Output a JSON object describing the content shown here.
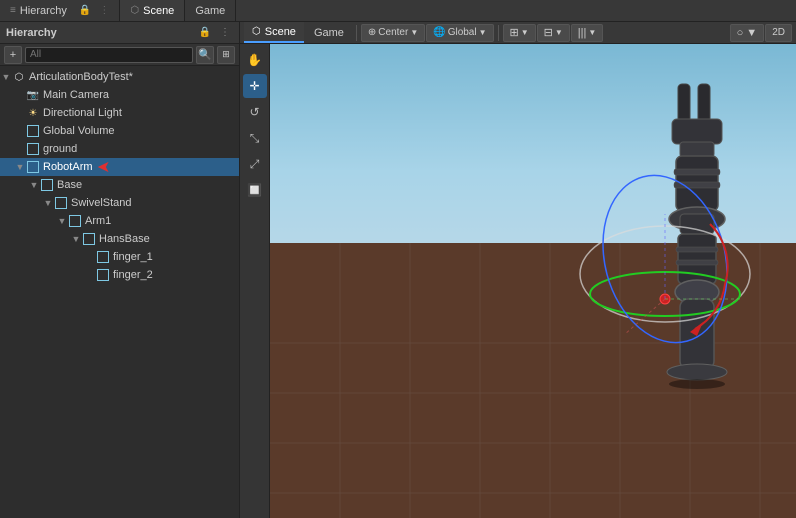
{
  "topBar": {
    "hierarchyTab": {
      "label": "Hierarchy",
      "icon": "≡",
      "active": false
    },
    "sceneTab": {
      "label": "Scene",
      "icon": "⬡",
      "active": true
    },
    "gameTab": {
      "label": "Game",
      "icon": "▷",
      "active": false
    }
  },
  "hierarchy": {
    "title": "Hierarchy",
    "lockIcon": "🔒",
    "menuIcon": "⋮",
    "addBtn": "+",
    "searchPlaceholder": "All",
    "tree": [
      {
        "id": "articulationbodytest",
        "label": "ArticulationBodyTest*",
        "depth": 0,
        "expanded": true,
        "type": "scene",
        "selected": false
      },
      {
        "id": "maincamera",
        "label": "Main Camera",
        "depth": 1,
        "expanded": false,
        "type": "camera",
        "selected": false
      },
      {
        "id": "directionallight",
        "label": "Directional Light",
        "depth": 1,
        "expanded": false,
        "type": "light",
        "selected": false
      },
      {
        "id": "globalvolume",
        "label": "Global Volume",
        "depth": 1,
        "expanded": false,
        "type": "cube",
        "selected": false
      },
      {
        "id": "ground",
        "label": "ground",
        "depth": 1,
        "expanded": false,
        "type": "cube",
        "selected": false
      },
      {
        "id": "robotarm",
        "label": "RobotArm",
        "depth": 1,
        "expanded": true,
        "type": "cube",
        "selected": true,
        "hasArrow": true
      },
      {
        "id": "base",
        "label": "Base",
        "depth": 2,
        "expanded": true,
        "type": "cube",
        "selected": false
      },
      {
        "id": "swivelstand",
        "label": "SwivelStand",
        "depth": 3,
        "expanded": true,
        "type": "cube",
        "selected": false
      },
      {
        "id": "arm1",
        "label": "Arm1",
        "depth": 4,
        "expanded": true,
        "type": "cube",
        "selected": false
      },
      {
        "id": "hansbase",
        "label": "HansBase",
        "depth": 5,
        "expanded": true,
        "type": "cube",
        "selected": false
      },
      {
        "id": "finger1",
        "label": "finger_1",
        "depth": 6,
        "expanded": false,
        "type": "cube",
        "selected": false
      },
      {
        "id": "finger2",
        "label": "finger_2",
        "depth": 6,
        "expanded": false,
        "type": "cube",
        "selected": false
      }
    ]
  },
  "sceneToolbar": {
    "centerBtn": "Center",
    "globalBtn": "Global",
    "centerIcon": "⊕",
    "globalIcon": "🌐",
    "tools": [
      "🖐",
      "✛",
      "↺",
      "⤡",
      "⤢",
      "🔲"
    ]
  },
  "scene": {
    "title": "Scene",
    "gameTitle": "Game",
    "btn2D": "2D"
  },
  "colors": {
    "sky1": "#7ab8d4",
    "sky2": "#b8d8e8",
    "ground": "#5a3a2a",
    "selected": "#2c5f8a",
    "accent": "#4a9eff",
    "robotBody": "#3a3a3a",
    "circleRed": "#cc2222",
    "circleBlue": "#2244cc",
    "circleGreen": "#22aa22",
    "circleWhite": "#cccccc"
  }
}
